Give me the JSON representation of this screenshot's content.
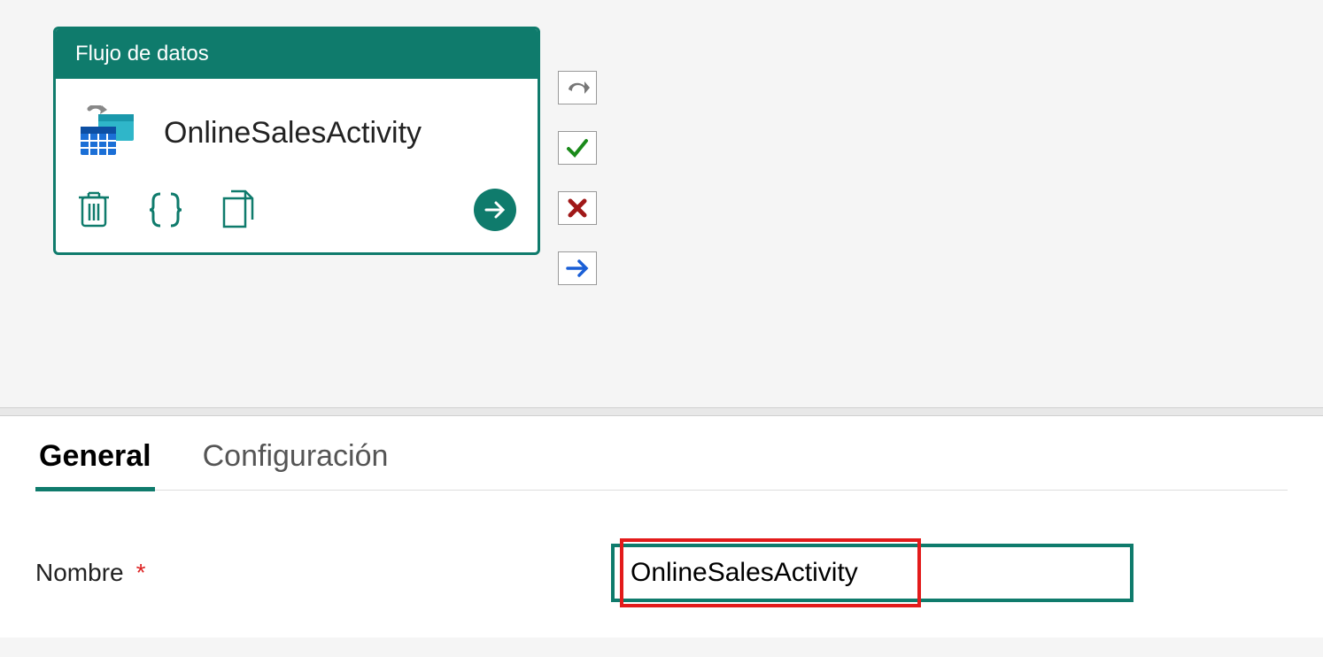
{
  "activity": {
    "type_label": "Flujo de datos",
    "name": "OnlineSalesActivity"
  },
  "tabs": {
    "general": "General",
    "configuracion": "Configuración"
  },
  "form": {
    "name_label": "Nombre",
    "required_mark": "*",
    "name_value": "OnlineSalesActivity"
  }
}
